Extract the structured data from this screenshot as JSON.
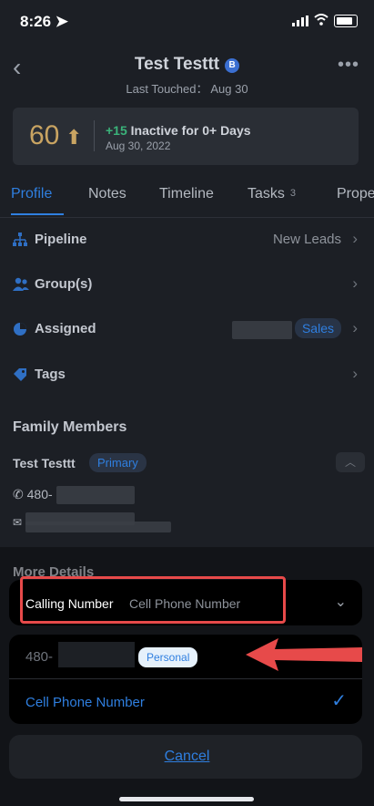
{
  "status": {
    "time": "8:26"
  },
  "header": {
    "name": "Test Testtt",
    "badge": "B",
    "subtitle": "Last Touched： Aug 30"
  },
  "score_card": {
    "score": "60",
    "delta": "+15",
    "delta_text": " Inactive for 0+ Days",
    "date": "Aug 30, 2022"
  },
  "tabs": [
    {
      "label": "Profile"
    },
    {
      "label": "Notes"
    },
    {
      "label": "Timeline"
    },
    {
      "label": "Tasks",
      "count": "3"
    },
    {
      "label": "Prope"
    }
  ],
  "rows": {
    "pipeline": {
      "label": "Pipeline",
      "value": "New Leads"
    },
    "groups": {
      "label": "Group(s)"
    },
    "assigned": {
      "label": "Assigned",
      "tag": "Sales"
    },
    "tags": {
      "label": "Tags"
    }
  },
  "family": {
    "heading": "Family Members",
    "member_name": "Test Testtt",
    "member_badge": "Primary",
    "phone_prefix": "480-"
  },
  "more_details": "More Details",
  "sheet": {
    "calling_label": "Calling Number",
    "calling_value": "Cell Phone Number",
    "option_number_prefix": "480-",
    "option_badge": "Personal",
    "option_cell": "Cell Phone Number",
    "cancel": "Cancel"
  },
  "colors": {
    "accent": "#2f7fe0",
    "highlight": "#e74a4a",
    "score": "#c9a462",
    "positive": "#3bb37a"
  }
}
